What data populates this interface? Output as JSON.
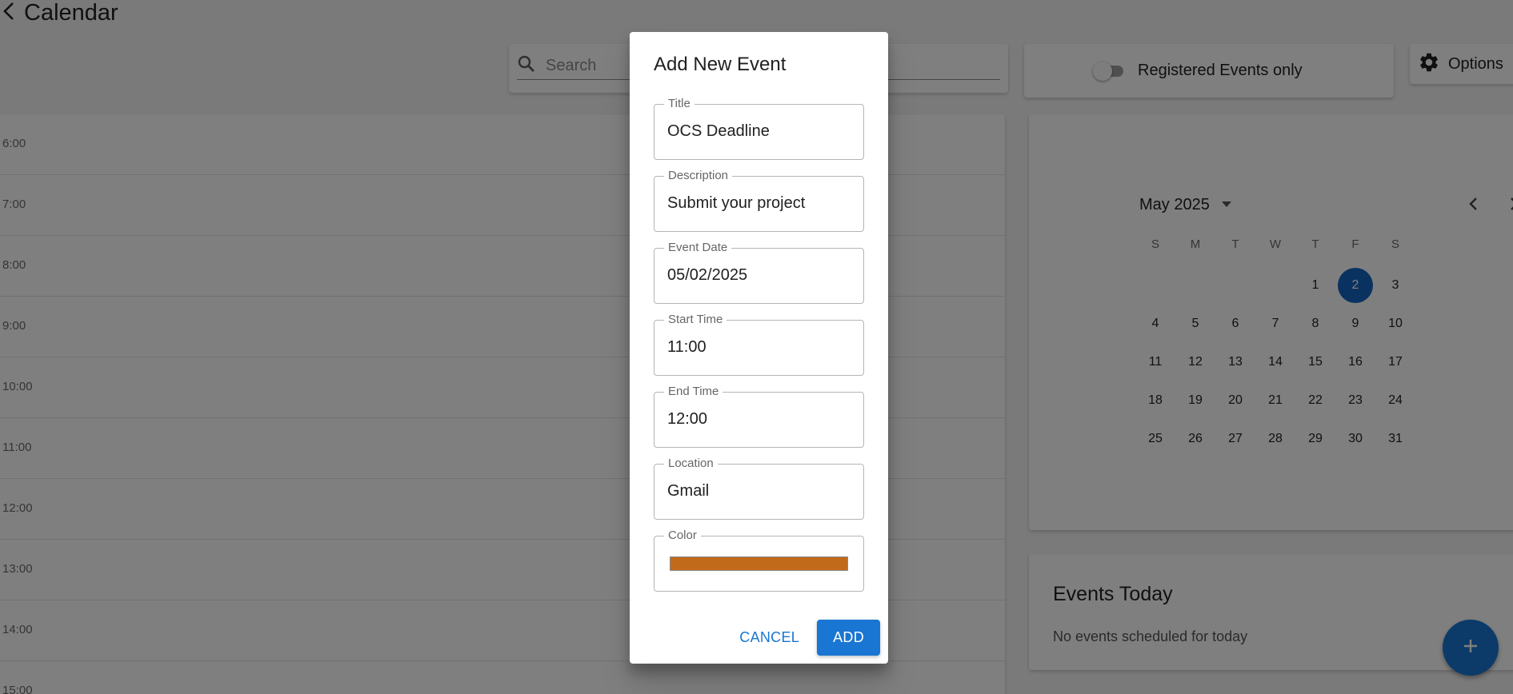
{
  "header": {
    "title": "Calendar"
  },
  "search": {
    "placeholder": "Search"
  },
  "toggle": {
    "label": "Registered Events only",
    "on": false
  },
  "options": {
    "label": "Options"
  },
  "schedule": {
    "hours": [
      "6:00",
      "7:00",
      "8:00",
      "9:00",
      "10:00",
      "11:00",
      "12:00",
      "13:00",
      "14:00",
      "15:00"
    ]
  },
  "mini_calendar": {
    "month_label": "May 2025",
    "weekdays": [
      "S",
      "M",
      "T",
      "W",
      "T",
      "F",
      "S"
    ],
    "leading_blanks": 4,
    "days": [
      1,
      2,
      3,
      4,
      5,
      6,
      7,
      8,
      9,
      10,
      11,
      12,
      13,
      14,
      15,
      16,
      17,
      18,
      19,
      20,
      21,
      22,
      23,
      24,
      25,
      26,
      27,
      28,
      29,
      30,
      31
    ],
    "selected_day": 2
  },
  "events_today": {
    "title": "Events Today",
    "empty_message": "No events scheduled for today"
  },
  "dialog": {
    "title": "Add New Event",
    "fields": {
      "title": {
        "label": "Title",
        "value": "OCS Deadline"
      },
      "description": {
        "label": "Description",
        "value": "Submit your project"
      },
      "event_date": {
        "label": "Event Date",
        "value": "05/02/2025"
      },
      "start_time": {
        "label": "Start Time",
        "value": "11:00"
      },
      "end_time": {
        "label": "End Time",
        "value": "12:00"
      },
      "location": {
        "label": "Location",
        "value": "Gmail"
      },
      "color": {
        "label": "Color",
        "value": "#c16a1a"
      }
    },
    "cancel_label": "CANCEL",
    "add_label": "ADD"
  },
  "theme": {
    "accent": "#1976d2",
    "selected_day": "#1565c0"
  }
}
